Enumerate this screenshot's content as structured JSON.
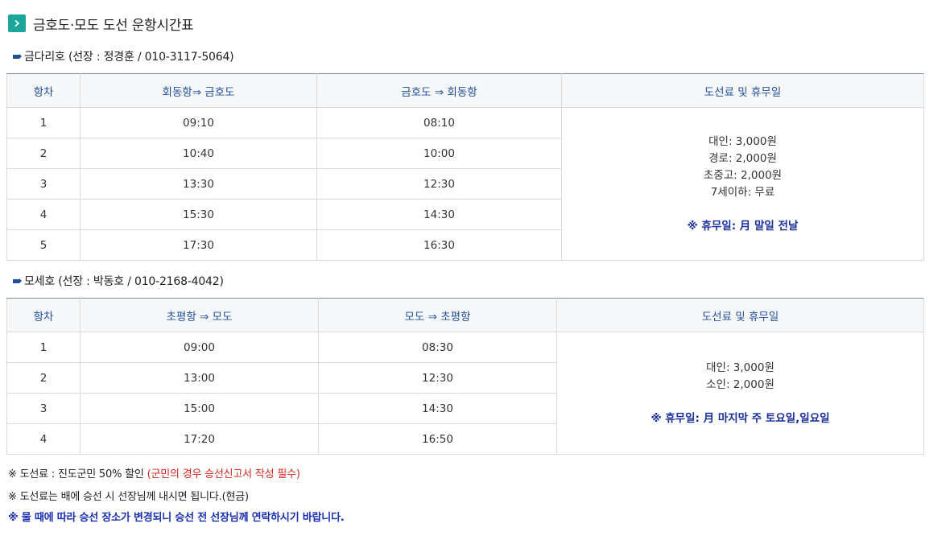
{
  "header": {
    "title": "금호도·모도 도선 운항시간표",
    "icon": "chevron-right-icon",
    "icon_color": "#1aa79a"
  },
  "sections": [
    {
      "vessel_label": "금다리호 (선장 : 정경훈 / 010-3117-5064)",
      "columns": [
        "항차",
        "회동항⇒ 금호도",
        "금호도 ⇒ 회동항",
        "도선료 및 휴무일"
      ],
      "rows": [
        {
          "no": "1",
          "out": "09:10",
          "back": "08:10"
        },
        {
          "no": "2",
          "out": "10:40",
          "back": "10:00"
        },
        {
          "no": "3",
          "out": "13:30",
          "back": "12:30"
        },
        {
          "no": "4",
          "out": "15:30",
          "back": "14:30"
        },
        {
          "no": "5",
          "out": "17:30",
          "back": "16:30"
        }
      ],
      "fares": [
        "대인: 3,000원",
        "경로: 2,000원",
        "초중고: 2,000원",
        "7세이하: 무료"
      ],
      "holiday": "※ 휴무일: 月 말일 전날"
    },
    {
      "vessel_label": "모세호 (선장 : 박동호 / 010-2168-4042)",
      "columns": [
        "항차",
        "초평항 ⇒ 모도",
        "모도 ⇒ 초평항",
        "도선료 및 휴무일"
      ],
      "rows": [
        {
          "no": "1",
          "out": "09:00",
          "back": "08:30"
        },
        {
          "no": "2",
          "out": "13:00",
          "back": "12:30"
        },
        {
          "no": "3",
          "out": "15:00",
          "back": "14:30"
        },
        {
          "no": "4",
          "out": "17:20",
          "back": "16:50"
        }
      ],
      "fares": [
        "대인: 3,000원",
        "소인: 2,000원"
      ],
      "holiday": "※ 휴무일: 月 마지막 주 토요일,일요일"
    }
  ],
  "notes": {
    "note1_main": "※ 도선료 : 진도군민 50% 할인 ",
    "note1_red": "(군민의 경우 승선신고서 작성 필수)",
    "note2": "※ 도선료는 배에 승선 시 선장님께 내시면 됩니다.(현금)",
    "note3": "※ 물 때에 따라 승선 장소가 변경되니 승선 전 선장님께 연락하시기 바랍니다."
  },
  "colors": {
    "accent": "#1aa79a",
    "header_text": "#1f4f9a",
    "holiday_text": "#1a2f9a",
    "warning_red": "#d4261e"
  }
}
